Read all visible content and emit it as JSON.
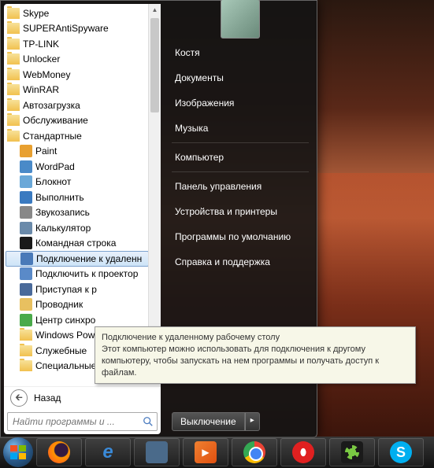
{
  "programs": {
    "top": [
      {
        "label": "Skype",
        "type": "folder"
      },
      {
        "label": "SUPERAntiSpyware",
        "type": "folder"
      },
      {
        "label": "TP-LINK",
        "type": "folder"
      },
      {
        "label": "Unlocker",
        "type": "folder"
      },
      {
        "label": "WebMoney",
        "type": "folder"
      },
      {
        "label": "WinRAR",
        "type": "folder"
      },
      {
        "label": "Автозагрузка",
        "type": "folder"
      },
      {
        "label": "Обслуживание",
        "type": "folder"
      },
      {
        "label": "Стандартные",
        "type": "folder"
      }
    ],
    "sub": [
      {
        "label": "Paint",
        "icon": "paint",
        "color": "#e8a030"
      },
      {
        "label": "WordPad",
        "icon": "wordpad",
        "color": "#4a8ac8"
      },
      {
        "label": "Блокнот",
        "icon": "notepad",
        "color": "#6aa8d8"
      },
      {
        "label": "Выполнить",
        "icon": "run",
        "color": "#3a7ac0"
      },
      {
        "label": "Звукозапись",
        "icon": "sound",
        "color": "#888888"
      },
      {
        "label": "Калькулятор",
        "icon": "calc",
        "color": "#6a8aaa"
      },
      {
        "label": "Командная строка",
        "icon": "cmd",
        "color": "#1a1a1a"
      },
      {
        "label": "Подключение к удаленн",
        "icon": "rdp",
        "color": "#4a7ab8",
        "highlighted": true
      },
      {
        "label": "Подключить к проектор",
        "icon": "projector",
        "color": "#5a8ac8"
      },
      {
        "label": "Приступая к р",
        "icon": "getting",
        "color": "#4a6a9a"
      },
      {
        "label": "Проводник",
        "icon": "explorer",
        "color": "#e8c060"
      },
      {
        "label": "Центр синхро",
        "icon": "sync",
        "color": "#4aaa4a"
      }
    ],
    "subfolders": [
      {
        "label": "Windows PowerShell",
        "type": "folder"
      },
      {
        "label": "Служебные",
        "type": "folder"
      },
      {
        "label": "Специальные возможн",
        "type": "folder"
      }
    ]
  },
  "back_label": "Назад",
  "search_placeholder": "Найти программы и ...",
  "right_panel": {
    "user": "Костя",
    "items": [
      "Документы",
      "Изображения",
      "Музыка"
    ],
    "items2": [
      "Компьютер"
    ],
    "items3": [
      "Панель управления",
      "Устройства и принтеры",
      "Программы по умолчанию",
      "Справка и поддержка"
    ]
  },
  "shutdown_label": "Выключение",
  "tooltip": {
    "title": "Подключение к удаленному рабочему столу",
    "body": "Этот компьютер можно использовать для подключения к другому компьютеру, чтобы запускать на нем программы и получать доступ к файлам."
  },
  "taskbar_icons": [
    {
      "name": "firefox",
      "bg": "#331a40",
      "fg": "#ff9500"
    },
    {
      "name": "ie",
      "bg": "transparent",
      "fg": "#3a8ad8"
    },
    {
      "name": "explorer",
      "bg": "#4a6a8a",
      "fg": "#e8c860"
    },
    {
      "name": "media",
      "bg": "transparent",
      "fg": "#f08030"
    },
    {
      "name": "chrome",
      "bg": "#fff",
      "fg": "#4285f4"
    },
    {
      "name": "opera",
      "bg": "transparent",
      "fg": "#e02020"
    },
    {
      "name": "icq",
      "bg": "#1a1a1a",
      "fg": "#7ac943"
    },
    {
      "name": "skype",
      "bg": "#00aff0",
      "fg": "#fff"
    }
  ]
}
